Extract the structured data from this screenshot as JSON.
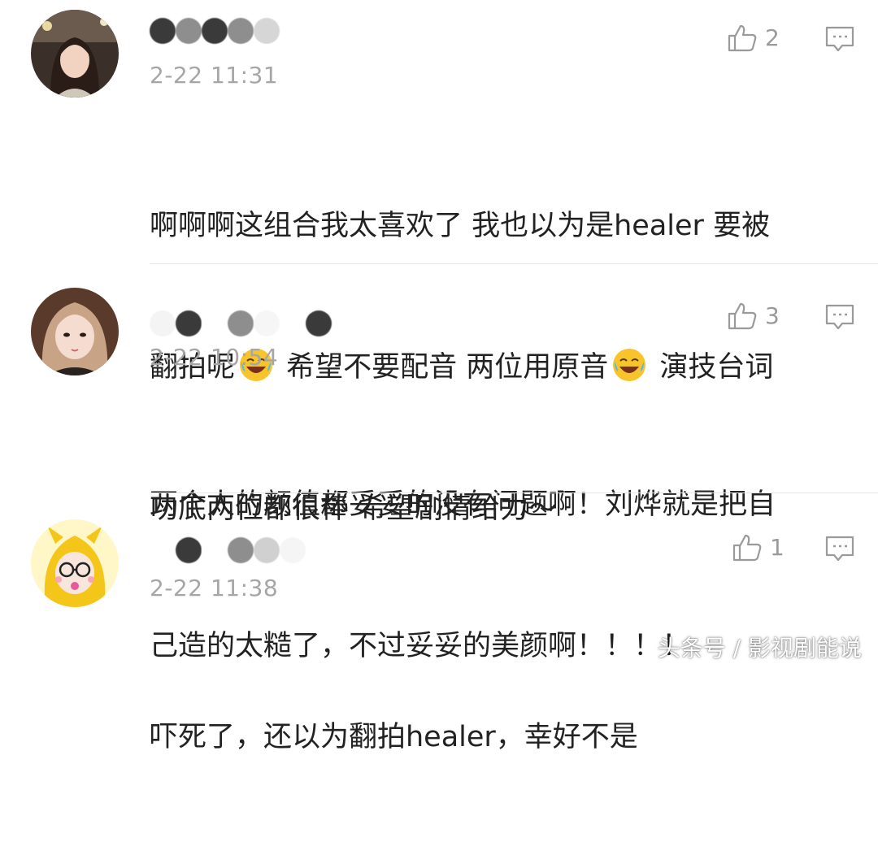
{
  "comments": [
    {
      "timestamp": "2-22 11:31",
      "likes": "2",
      "text_a": "啊啊啊这组合我太喜欢了 我也以为是healer 要被",
      "text_b_1": "翻拍呢",
      "text_b_2": " 希望不要配音 两位用原音",
      "text_b_3": " 演技台词",
      "text_c": "功底两位都很棒 希望剧情给力～",
      "emoji": "laugh-cry-emoji"
    },
    {
      "timestamp": "2-22 10:54",
      "likes": "3",
      "text_a": "两个人的颜值都妥妥的没有问题啊！刘烨就是把自",
      "text_b": "己造的太糙了，不过妥妥的美颜啊！！！！"
    },
    {
      "timestamp": "2-22 11:38",
      "likes": "1",
      "text_a": "吓死了，还以为翻拍healer，幸好不是"
    }
  ],
  "watermark": "头条号 / 影视剧能说",
  "colors": {
    "timestamp": "#a6a6a6",
    "text": "#222222",
    "icon": "#9a9a9a"
  }
}
